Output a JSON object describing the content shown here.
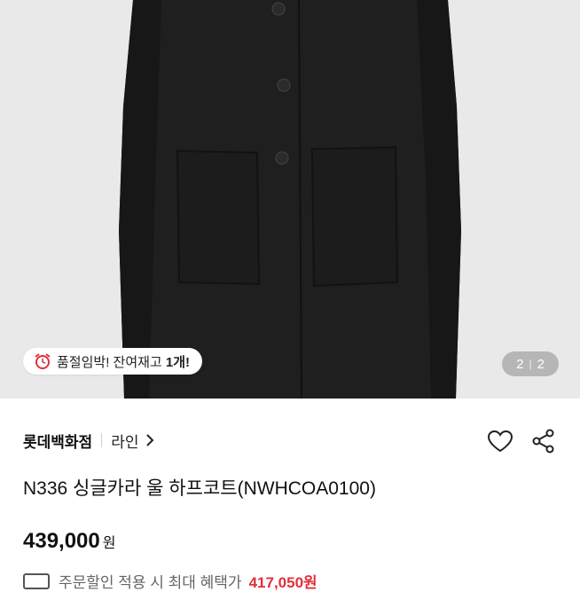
{
  "hero": {
    "image": "black-wool-half-coat-photo",
    "stock_badge": {
      "icon": "alarm-clock-icon",
      "text": "품절임박! 잔여재고 ",
      "count": "1개!"
    },
    "page_indicator": {
      "current": "2",
      "total": "2"
    }
  },
  "product": {
    "brand": "롯데백화점",
    "line": "라인",
    "title": "N336 싱글카라 울 하프코트(NWHCOA0100)",
    "price": "439,000",
    "currency": "원",
    "benefit_text": "주문할인 적용 시 최대 혜택가",
    "benefit_price": "417,050원"
  },
  "colors": {
    "accent_red": "#e0303a",
    "hero_bg": "#e9e9ea",
    "coat": "#1e1e1f"
  }
}
